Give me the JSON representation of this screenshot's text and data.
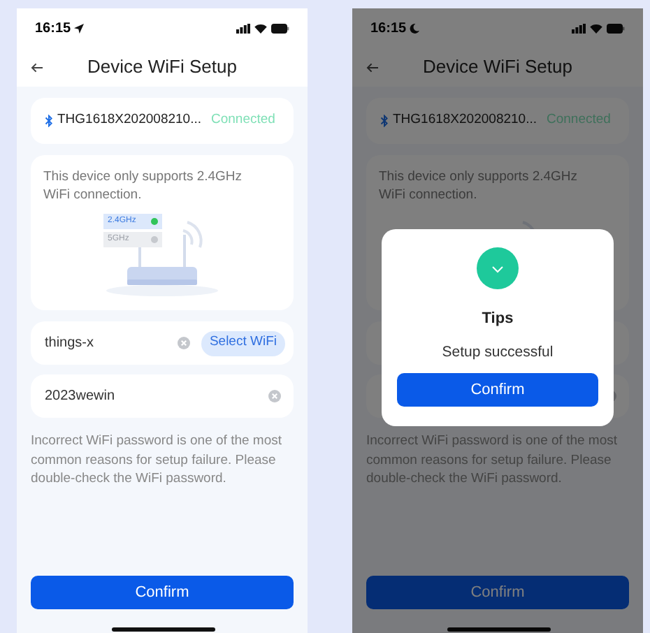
{
  "screens": [
    {
      "status_bar": {
        "time": "16:15",
        "kind": "location"
      },
      "title": "Device WiFi Setup",
      "device": {
        "name": "THG1618X202008210...",
        "status": "Connected"
      },
      "notice": "This device only supports 2.4GHz WiFi connection.",
      "bands": [
        {
          "label": "2.4GHz",
          "selected": true
        },
        {
          "label": "5GHz",
          "selected": false
        }
      ],
      "ssid_field": {
        "value": "things-x"
      },
      "select_button": "Select WiFi",
      "password_field": {
        "value": "2023wewin"
      },
      "hint": "Incorrect WiFi password is one of the most common reasons for setup failure. Please double-check the WiFi password.",
      "confirm": "Confirm"
    },
    {
      "status_bar": {
        "time": "16:15",
        "kind": "moon"
      },
      "title": "Device WiFi Setup",
      "device": {
        "name": "THG1618X202008210...",
        "status": "Connected"
      },
      "notice": "This device only supports 2.4GHz WiFi connection.",
      "hint": "Incorrect WiFi password is one of the most common reasons for setup failure. Please double-check the WiFi password.",
      "confirm": "Confirm",
      "dialog": {
        "title": "Tips",
        "message": "Setup successful",
        "button": "Confirm"
      }
    }
  ]
}
